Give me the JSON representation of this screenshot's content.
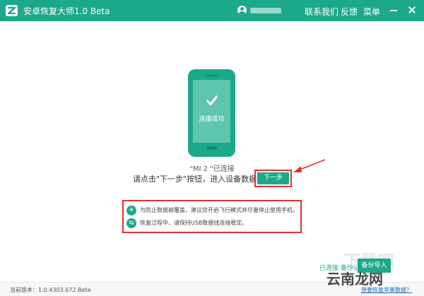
{
  "titlebar": {
    "app_title": "安卓恢复大师1.0 Beta",
    "menu": {
      "contact": "联系我们",
      "feedback": "反馈",
      "menu": "菜单"
    }
  },
  "phone": {
    "status": "连接成功"
  },
  "main": {
    "device_connected": "\"MI 2 \"已连接",
    "instruction": "请点击\"下一步\"按钮，进入设备数据扫描",
    "next_button": "下一步"
  },
  "tips": [
    {
      "icon": "airplane-icon",
      "text": "为防止数据被覆盖，建议您开启飞行模式并尽量停止使用手机。"
    },
    {
      "icon": "usb-icon",
      "text": "恢复过程中，请保持USB数据线连接稳定。"
    }
  ],
  "bottom": {
    "link_connected": "已连接",
    "link_separator": " ",
    "link_backup": "备份记录",
    "import_button": "备份导入",
    "version": "当前版本：1.0.4303.672 Beta",
    "help_link": "想要恢复苹果数据？"
  },
  "watermark": {
    "text": "云南龙网",
    "bg_text": "下载吧"
  },
  "colors": {
    "accent": "#1aa98a",
    "highlight": "#e03030"
  }
}
